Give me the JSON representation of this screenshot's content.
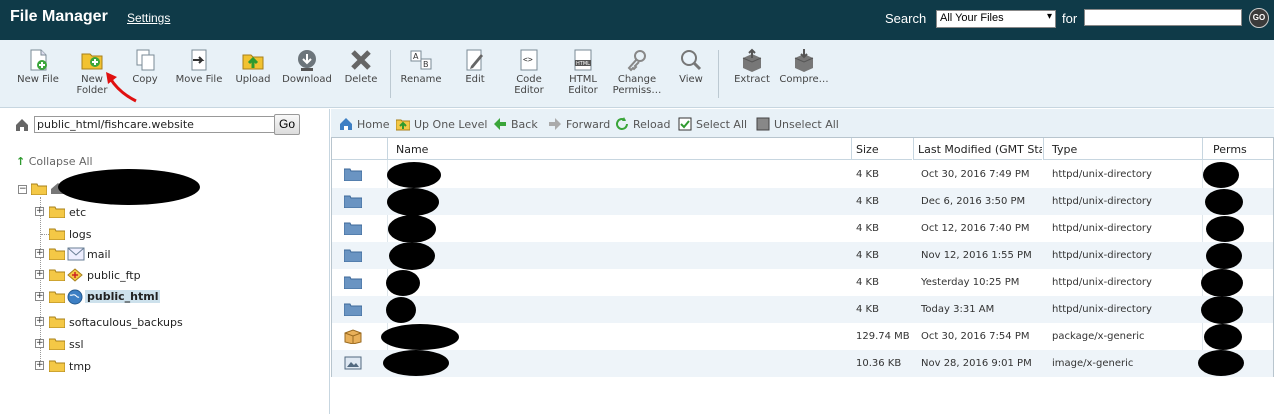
{
  "header": {
    "title": "File Manager",
    "settings_label": "Settings",
    "search_label": "Search",
    "search_scope": "All Your Files",
    "for_label": "for",
    "search_value": "",
    "go_label": "GO"
  },
  "toolbar": {
    "items": [
      {
        "label": "New File",
        "icon": "new-file-icon"
      },
      {
        "label": "New\nFolder",
        "icon": "new-folder-icon"
      },
      {
        "label": "Copy",
        "icon": "copy-icon"
      },
      {
        "label": "Move File",
        "icon": "move-file-icon"
      },
      {
        "label": "Upload",
        "icon": "upload-icon"
      },
      {
        "label": "Download",
        "icon": "download-icon"
      },
      {
        "label": "Delete",
        "icon": "delete-icon"
      },
      {
        "label": "Rename",
        "icon": "rename-icon"
      },
      {
        "label": "Edit",
        "icon": "edit-icon"
      },
      {
        "label": "Code\nEditor",
        "icon": "code-editor-icon"
      },
      {
        "label": "HTML\nEditor",
        "icon": "html-editor-icon"
      },
      {
        "label": "Change\nPermiss…",
        "icon": "permissions-icon"
      },
      {
        "label": "View",
        "icon": "view-icon"
      },
      {
        "label": "Extract",
        "icon": "extract-icon"
      },
      {
        "label": "Compre…",
        "icon": "compress-icon"
      }
    ]
  },
  "left": {
    "path_value": "public_html/fishcare.website",
    "go_label": "Go",
    "collapse_all": "Collapse All",
    "tree": [
      {
        "label": "etc"
      },
      {
        "label": "logs"
      },
      {
        "label": "mail"
      },
      {
        "label": "public_ftp"
      },
      {
        "label": "public_html",
        "selected": true
      },
      {
        "label": "softaculous_backups"
      },
      {
        "label": "ssl"
      },
      {
        "label": "tmp"
      }
    ]
  },
  "nav": {
    "home": "Home",
    "up": "Up One Level",
    "back": "Back",
    "forward": "Forward",
    "reload": "Reload",
    "select_all": "Select All",
    "unselect_all": "Unselect All"
  },
  "table": {
    "headers": {
      "name": "Name",
      "size": "Size",
      "modified": "Last Modified (GMT Standard Time)",
      "type": "Type",
      "perms": "Perms"
    },
    "rows": [
      {
        "size": "4 KB",
        "modified": "Oct 30, 2016 7:49 PM",
        "type": "httpd/unix-directory",
        "icon": "folder-icon"
      },
      {
        "size": "4 KB",
        "modified": "Dec 6, 2016 3:50 PM",
        "type": "httpd/unix-directory",
        "icon": "folder-icon"
      },
      {
        "size": "4 KB",
        "modified": "Oct 12, 2016 7:40 PM",
        "type": "httpd/unix-directory",
        "icon": "folder-icon"
      },
      {
        "size": "4 KB",
        "modified": "Nov 12, 2016 1:55 PM",
        "type": "httpd/unix-directory",
        "icon": "folder-icon"
      },
      {
        "size": "4 KB",
        "modified": "Yesterday 10:25 PM",
        "type": "httpd/unix-directory",
        "icon": "folder-icon"
      },
      {
        "size": "4 KB",
        "modified": "Today 3:31 AM",
        "type": "httpd/unix-directory",
        "icon": "folder-icon"
      },
      {
        "size": "129.74 MB",
        "modified": "Oct 30, 2016 7:54 PM",
        "type": "package/x-generic",
        "icon": "package-icon"
      },
      {
        "size": "10.36 KB",
        "modified": "Nov 28, 2016 9:01 PM",
        "type": "image/x-generic",
        "icon": "image-icon"
      }
    ]
  },
  "colors": {
    "header_bg": "#0f3a48",
    "toolbar_bg": "#e8f1f7",
    "row_alt": "#eef4f9",
    "annotation_arrow": "#e01010"
  }
}
